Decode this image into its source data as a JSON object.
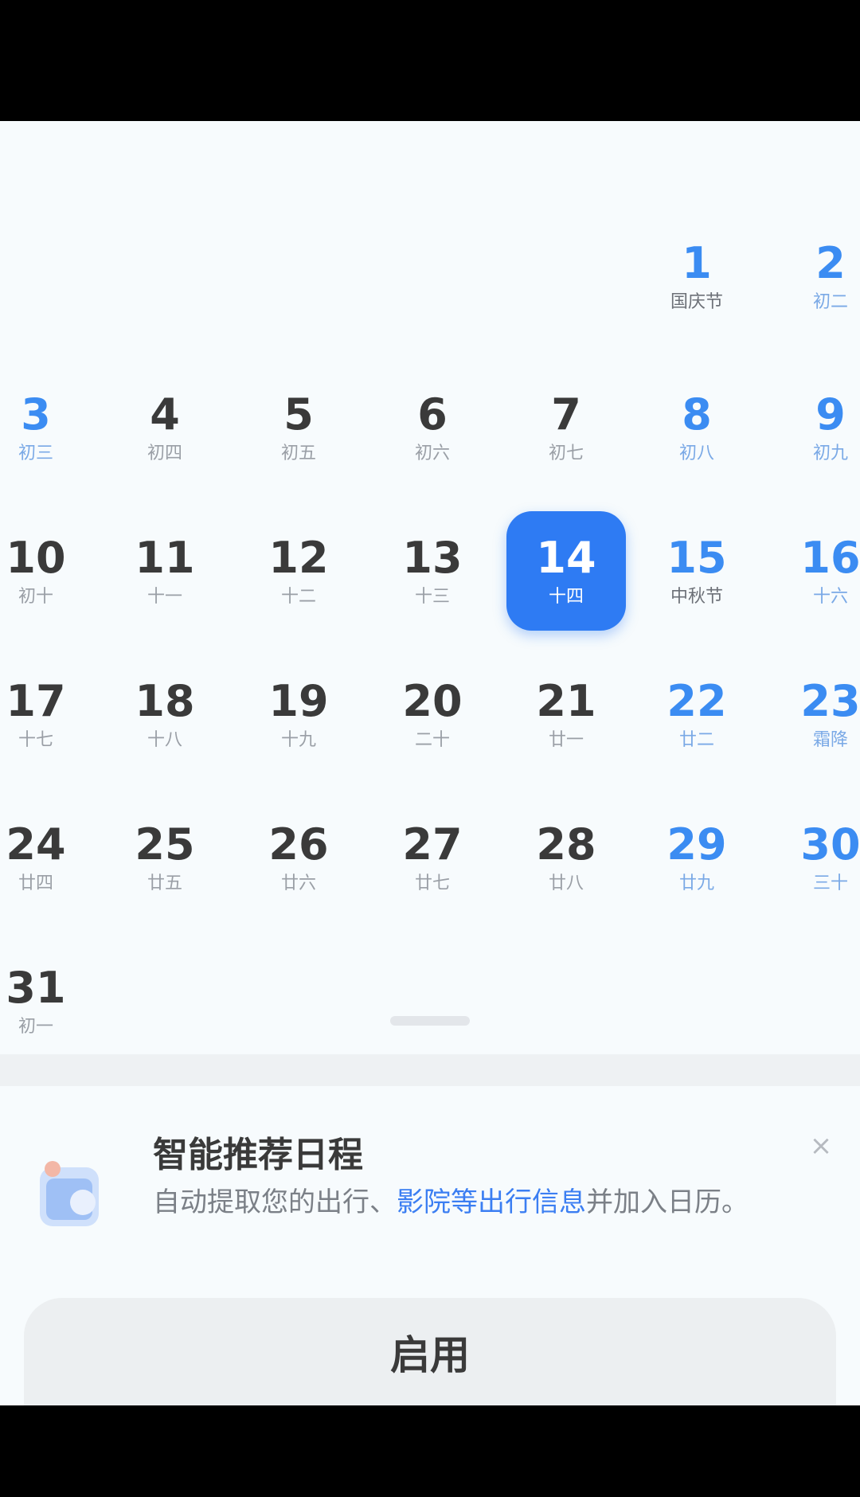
{
  "calendar": {
    "month_days": [
      {
        "num": "1",
        "sub": "国庆节",
        "col": 5,
        "row": 0,
        "weekend": true,
        "holiday": true
      },
      {
        "num": "2",
        "sub": "初二",
        "col": 6,
        "row": 0,
        "weekend": true
      },
      {
        "num": "3",
        "sub": "初三",
        "col": 0,
        "row": 1,
        "weekend": true
      },
      {
        "num": "4",
        "sub": "初四",
        "col": 1,
        "row": 1
      },
      {
        "num": "5",
        "sub": "初五",
        "col": 2,
        "row": 1
      },
      {
        "num": "6",
        "sub": "初六",
        "col": 3,
        "row": 1
      },
      {
        "num": "7",
        "sub": "初七",
        "col": 4,
        "row": 1
      },
      {
        "num": "8",
        "sub": "初八",
        "col": 5,
        "row": 1,
        "weekend": true
      },
      {
        "num": "9",
        "sub": "初九",
        "col": 6,
        "row": 1,
        "weekend": true
      },
      {
        "num": "10",
        "sub": "初十",
        "col": 0,
        "row": 2
      },
      {
        "num": "11",
        "sub": "十一",
        "col": 1,
        "row": 2
      },
      {
        "num": "12",
        "sub": "十二",
        "col": 2,
        "row": 2
      },
      {
        "num": "13",
        "sub": "十三",
        "col": 3,
        "row": 2
      },
      {
        "num": "14",
        "sub": "十四",
        "col": 4,
        "row": 2,
        "selected": true
      },
      {
        "num": "15",
        "sub": "中秋节",
        "col": 5,
        "row": 2,
        "weekend": true,
        "holiday": true
      },
      {
        "num": "16",
        "sub": "十六",
        "col": 6,
        "row": 2,
        "weekend": true
      },
      {
        "num": "17",
        "sub": "十七",
        "col": 0,
        "row": 3
      },
      {
        "num": "18",
        "sub": "十八",
        "col": 1,
        "row": 3
      },
      {
        "num": "19",
        "sub": "十九",
        "col": 2,
        "row": 3
      },
      {
        "num": "20",
        "sub": "二十",
        "col": 3,
        "row": 3
      },
      {
        "num": "21",
        "sub": "廿一",
        "col": 4,
        "row": 3
      },
      {
        "num": "22",
        "sub": "廿二",
        "col": 5,
        "row": 3,
        "weekend": true
      },
      {
        "num": "23",
        "sub": "霜降",
        "col": 6,
        "row": 3,
        "weekend": true
      },
      {
        "num": "24",
        "sub": "廿四",
        "col": 0,
        "row": 4
      },
      {
        "num": "25",
        "sub": "廿五",
        "col": 1,
        "row": 4
      },
      {
        "num": "26",
        "sub": "廿六",
        "col": 2,
        "row": 4
      },
      {
        "num": "27",
        "sub": "廿七",
        "col": 3,
        "row": 4
      },
      {
        "num": "28",
        "sub": "廿八",
        "col": 4,
        "row": 4
      },
      {
        "num": "29",
        "sub": "廿九",
        "col": 5,
        "row": 4,
        "weekend": true
      },
      {
        "num": "30",
        "sub": "三十",
        "col": 6,
        "row": 4,
        "weekend": true
      },
      {
        "num": "31",
        "sub": "初一",
        "col": 0,
        "row": 5
      }
    ]
  },
  "banner": {
    "title": "智能推荐日程",
    "desc_prefix": "自动提取您的出行、",
    "desc_highlight": "影院等出行信息",
    "desc_suffix": "并加入日历。",
    "close_glyph": "×",
    "icon": "calendar-app-icon"
  },
  "setup_button": {
    "label": "启用"
  },
  "colors": {
    "accent": "#2e7bf3",
    "weekend": "#3b8cf2",
    "background": "#f7fbfd"
  }
}
